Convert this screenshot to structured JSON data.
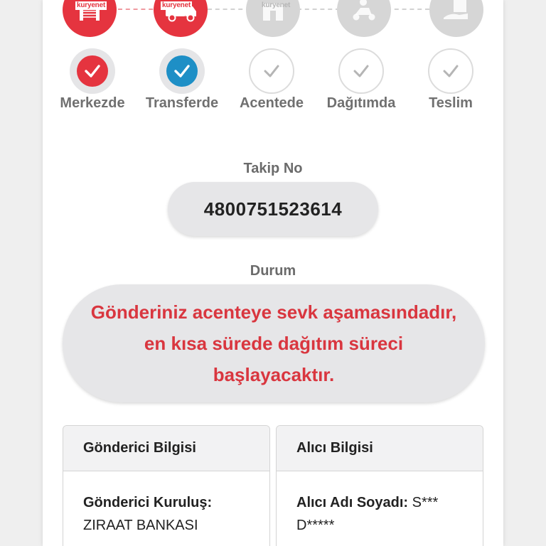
{
  "colors": {
    "accent_red": "#e5343f",
    "accent_blue": "#1e8fc6",
    "status_text": "#d9363f",
    "muted_grey": "#d6d6d6"
  },
  "brand": {
    "logo_text": "kuryenet"
  },
  "stages": [
    {
      "label": "Merkezde",
      "state": "done",
      "check_color": "red",
      "icon": "warehouse-icon"
    },
    {
      "label": "Transferde",
      "state": "current",
      "check_color": "blue",
      "icon": "delivery-truck-icon"
    },
    {
      "label": "Acentede",
      "state": "pending",
      "check_color": "grey",
      "icon": "agency-building-icon"
    },
    {
      "label": "Dağıtımda",
      "state": "pending",
      "check_color": "grey",
      "icon": "courier-scooter-icon"
    },
    {
      "label": "Teslim",
      "state": "pending",
      "check_color": "grey",
      "icon": "package-handover-icon"
    }
  ],
  "tracking": {
    "label": "Takip No",
    "number": "4800751523614"
  },
  "status": {
    "label": "Durum",
    "line1": "Gönderiniz acenteye sevk aşamasındadır,",
    "line2": "en kısa sürede dağıtım süreci",
    "line3": "başlayacaktır."
  },
  "sender": {
    "title": "Gönderici Bilgisi",
    "org_key": "Gönderici Kuruluş:",
    "org_value": "ZIRAAT BANKASI"
  },
  "recipient": {
    "title": "Alıcı Bilgisi",
    "name_key": "Alıcı Adı Soyadı:",
    "name_value": "S*** D*****"
  }
}
